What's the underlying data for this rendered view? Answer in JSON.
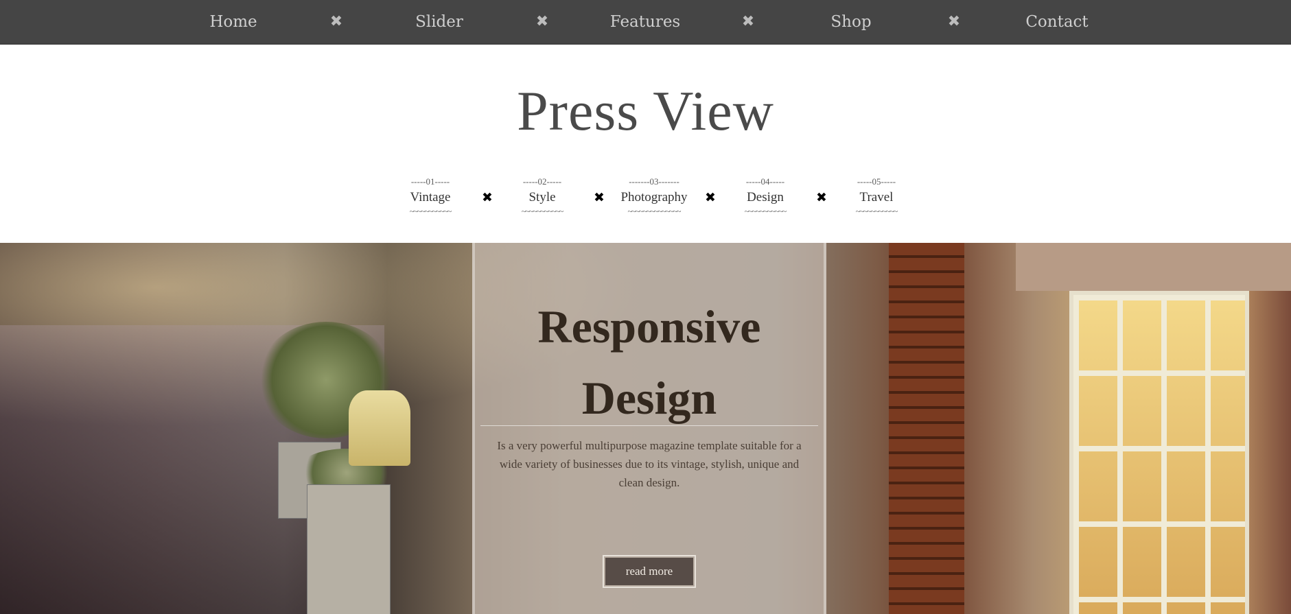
{
  "nav": {
    "items": [
      {
        "label": "Home"
      },
      {
        "label": "Slider"
      },
      {
        "label": "Features"
      },
      {
        "label": "Shop"
      },
      {
        "label": "Contact"
      }
    ],
    "separator": "✖",
    "background": "#454545",
    "text_color": "#cfcfcf"
  },
  "site": {
    "title": "Press View"
  },
  "categories": {
    "items": [
      {
        "num": "-----01-----",
        "label": "Vintage",
        "under": "~~~~~~~~~~~"
      },
      {
        "num": "-----02-----",
        "label": "Style",
        "under": "~~~~~~~~~~~"
      },
      {
        "num": "-------03-------",
        "label": "Photography",
        "under": "~~~~~~~~~~~~~~"
      },
      {
        "num": "-----04-----",
        "label": "Design",
        "under": "~~~~~~~~~~~"
      },
      {
        "num": "-----05-----",
        "label": "Travel",
        "under": "~~~~~~~~~~~"
      }
    ],
    "separator": "✖"
  },
  "hero": {
    "title_line1": "Responsive",
    "title_line2": "Design",
    "description": "Is a very powerful multipurpose magazine template suitable for a wide variety of businesses due to its vintage, stylish, unique and clean design.",
    "button_label": "read more",
    "panel_color": "#cec4bc"
  }
}
